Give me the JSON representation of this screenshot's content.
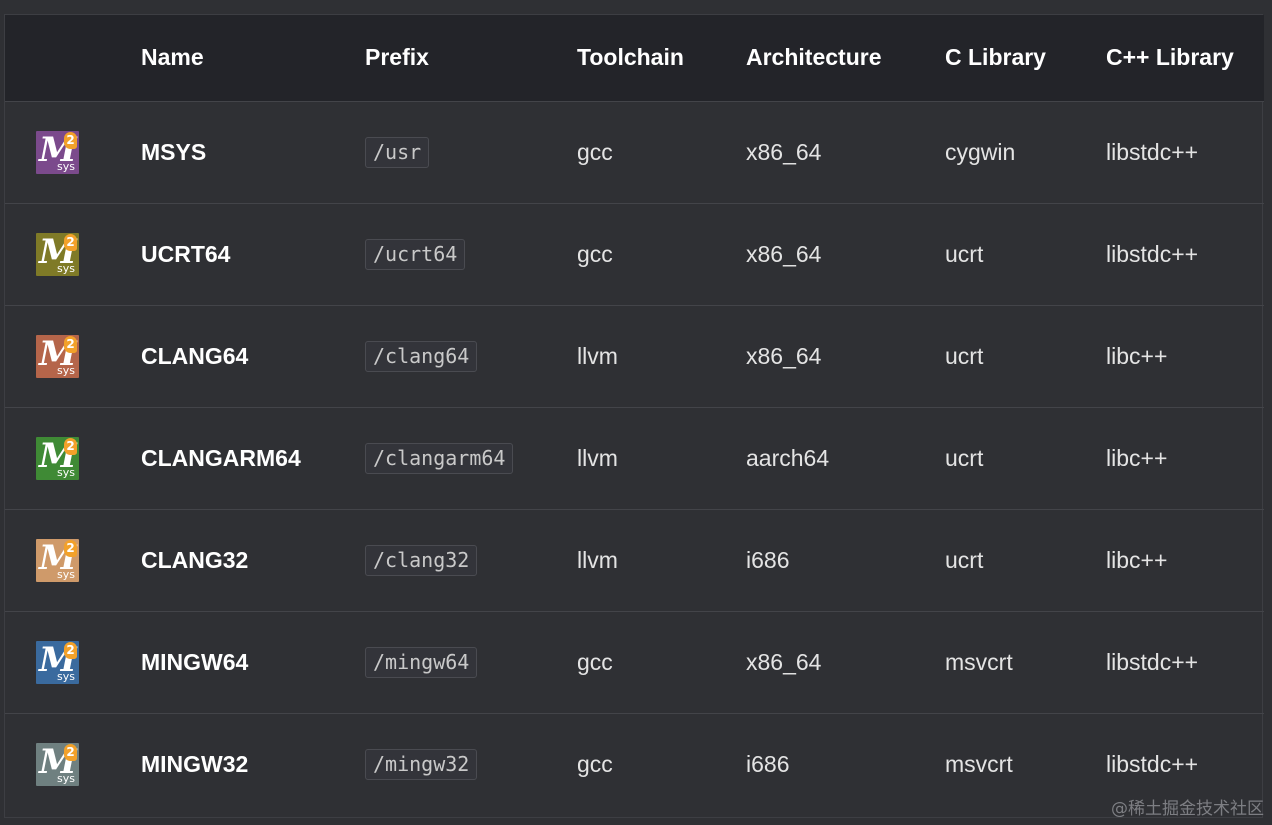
{
  "table": {
    "headers": {
      "icon": "",
      "name": "Name",
      "prefix": "Prefix",
      "toolchain": "Toolchain",
      "architecture": "Architecture",
      "c_library": "C Library",
      "cpp_library": "C++ Library"
    },
    "logo": {
      "letter": "M",
      "badge": "2",
      "sub": "sys"
    },
    "rows": [
      {
        "icon_color": "#7b4a8c",
        "name": "MSYS",
        "prefix": "/usr",
        "toolchain": "gcc",
        "architecture": "x86_64",
        "c_library": "cygwin",
        "cpp_library": "libstdc++"
      },
      {
        "icon_color": "#7f7a27",
        "name": "UCRT64",
        "prefix": "/ucrt64",
        "toolchain": "gcc",
        "architecture": "x86_64",
        "c_library": "ucrt",
        "cpp_library": "libstdc++"
      },
      {
        "icon_color": "#b5654a",
        "name": "CLANG64",
        "prefix": "/clang64",
        "toolchain": "llvm",
        "architecture": "x86_64",
        "c_library": "ucrt",
        "cpp_library": "libc++"
      },
      {
        "icon_color": "#3f8a35",
        "name": "CLANGARM64",
        "prefix": "/clangarm64",
        "toolchain": "llvm",
        "architecture": "aarch64",
        "c_library": "ucrt",
        "cpp_library": "libc++"
      },
      {
        "icon_color": "#cf9a6a",
        "name": "CLANG32",
        "prefix": "/clang32",
        "toolchain": "llvm",
        "architecture": "i686",
        "c_library": "ucrt",
        "cpp_library": "libc++"
      },
      {
        "icon_color": "#3a6a9e",
        "name": "MINGW64",
        "prefix": "/mingw64",
        "toolchain": "gcc",
        "architecture": "x86_64",
        "c_library": "msvcrt",
        "cpp_library": "libstdc++"
      },
      {
        "icon_color": "#6f8080",
        "name": "MINGW32",
        "prefix": "/mingw32",
        "toolchain": "gcc",
        "architecture": "i686",
        "c_library": "msvcrt",
        "cpp_library": "libstdc++"
      }
    ]
  },
  "watermark": "@稀土掘金技术社区"
}
